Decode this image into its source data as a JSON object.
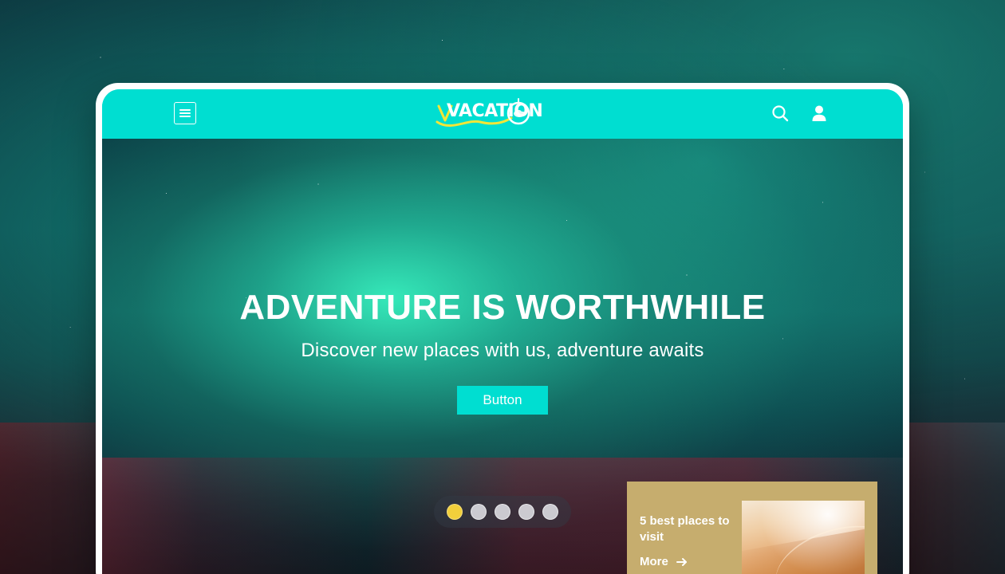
{
  "brand": {
    "logo_text": "VACATION"
  },
  "hero": {
    "title": "ADVENTURE IS WORTHWHILE",
    "subtitle": "Discover new places with us, adventure awaits",
    "button_label": "Button"
  },
  "carousel": {
    "active_index": 0,
    "count": 5
  },
  "promo": {
    "title": "5 best places to visit",
    "more_label": "More"
  },
  "colors": {
    "accent": "#00DED1",
    "indicator_active": "#F2CF3B",
    "promo_bg": "#C6AD6E"
  },
  "icons": {
    "menu": "menu-icon",
    "search": "search-icon",
    "user": "user-icon",
    "more": "arrow-right-icon"
  }
}
